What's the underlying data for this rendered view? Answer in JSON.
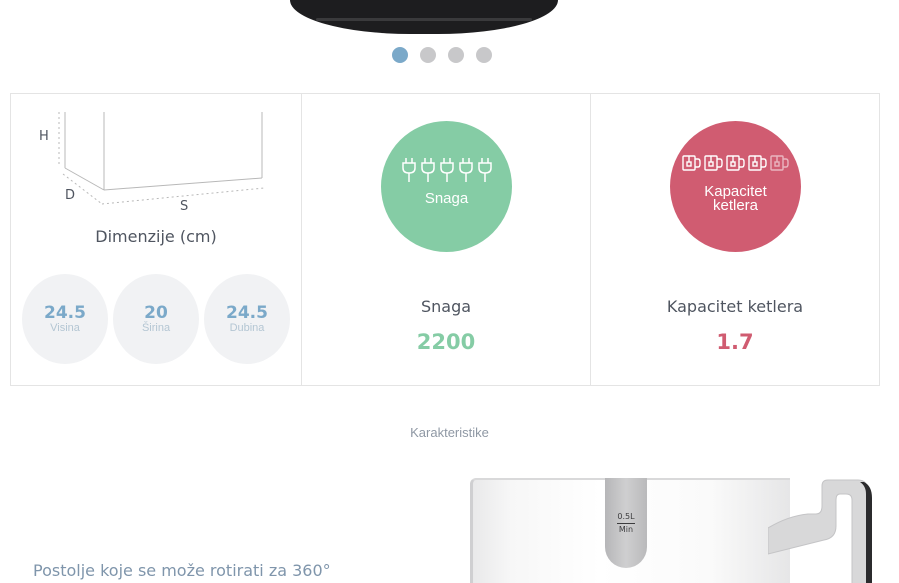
{
  "carousel": {
    "slides": 4,
    "active": 1
  },
  "dimensions": {
    "axis_h": "H",
    "axis_d": "D",
    "axis_s": "S",
    "title": "Dimenzije (cm)",
    "items": [
      {
        "value": "24.5",
        "label": "Visina"
      },
      {
        "value": "20",
        "label": "Širina"
      },
      {
        "value": "24.5",
        "label": "Dubina"
      }
    ]
  },
  "power": {
    "circle_label": "Snaga",
    "icon": "plug-icon",
    "icon_count": 5,
    "name": "Snaga",
    "value": "2200",
    "color": "#85cca5"
  },
  "capacity": {
    "circle_label_line1": "Kapacitet",
    "circle_label_line2": "ketlera",
    "icon": "mug-icon",
    "icon_count": 5,
    "name": "Kapacitet ketlera",
    "value": "1.7",
    "color": "#d05c71"
  },
  "section_title": "Karakteristike",
  "feature": {
    "text": "Postolje koje se može rotirati za 360°",
    "window_top": "0.5L",
    "window_bottom": "Min"
  },
  "colors": {
    "accent": "#7ba9c9",
    "green": "#85cca5",
    "red": "#d05c71"
  }
}
